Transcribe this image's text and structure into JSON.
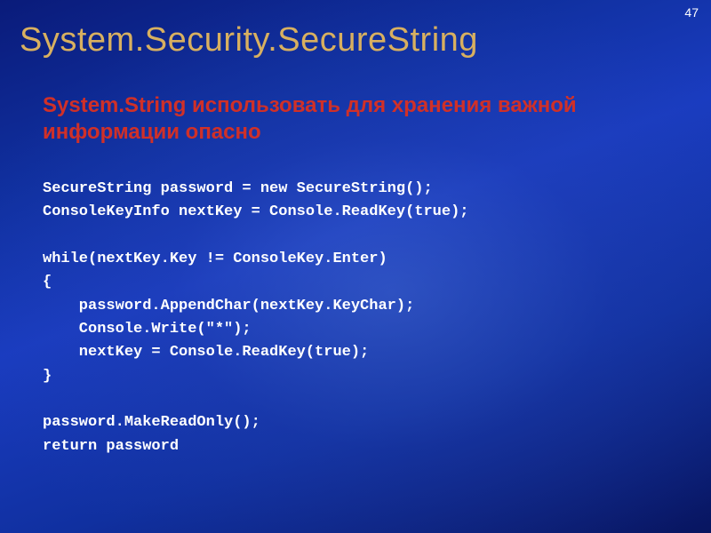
{
  "slide": {
    "page_number": "47",
    "title": "System.Security.SecureString",
    "subtitle": "System.String использовать для хранения важной информации опасно",
    "code": "SecureString password = new SecureString();\nConsoleKeyInfo nextKey = Console.ReadKey(true);\n\nwhile(nextKey.Key != ConsoleKey.Enter)\n{\n    password.AppendChar(nextKey.KeyChar);\n    Console.Write(\"*\");\n    nextKey = Console.ReadKey(true);\n}\n\npassword.MakeReadOnly();\nreturn password"
  }
}
